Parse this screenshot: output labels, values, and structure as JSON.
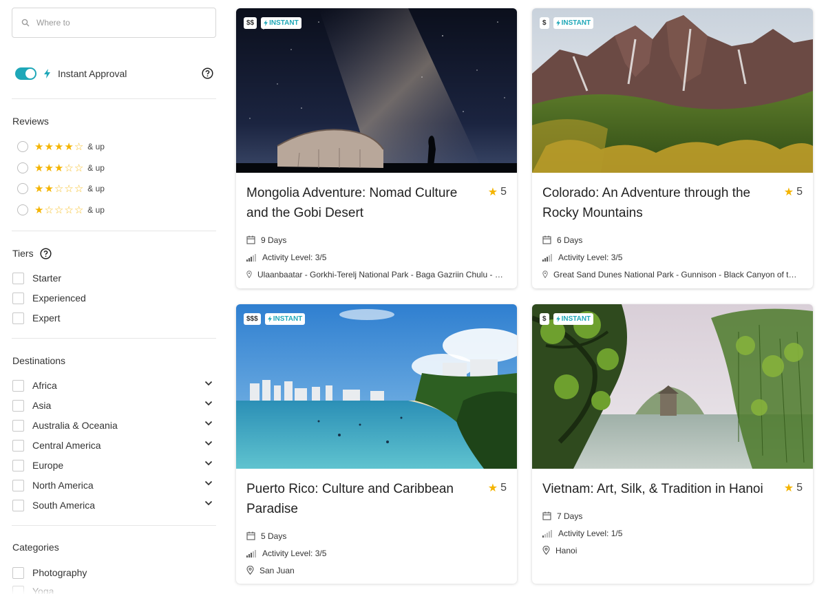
{
  "search": {
    "placeholder": "Where to"
  },
  "instant_approval": {
    "label": "Instant Approval",
    "enabled": true
  },
  "reviews": {
    "title": "Reviews",
    "options": [
      {
        "stars": 4,
        "suffix": "& up"
      },
      {
        "stars": 3,
        "suffix": "& up"
      },
      {
        "stars": 2,
        "suffix": "& up"
      },
      {
        "stars": 1,
        "suffix": "& up"
      }
    ]
  },
  "tiers": {
    "title": "Tiers",
    "options": [
      "Starter",
      "Experienced",
      "Expert"
    ]
  },
  "destinations": {
    "title": "Destinations",
    "options": [
      "Africa",
      "Asia",
      "Australia & Oceania",
      "Central America",
      "Europe",
      "North America",
      "South America"
    ]
  },
  "categories": {
    "title": "Categories",
    "options": [
      "Photography",
      "Yoga"
    ]
  },
  "colors": {
    "accent": "#1ea7b8",
    "star": "#f4b400"
  },
  "trips": [
    {
      "price": "$$",
      "instant": "INSTANT",
      "title": "Mongolia Adventure: Nomad Culture and the Gobi Desert",
      "rating": "5",
      "duration": "9 Days",
      "activity": "Activity Level: 3/5",
      "location": "Ulaanbaatar - Gorkhi-Terelj National Park - Baga Gazriin Chulu - Gobi Desert"
    },
    {
      "price": "$",
      "instant": "INSTANT",
      "title": "Colorado: An Adventure through the Rocky Mountains",
      "rating": "5",
      "duration": "6 Days",
      "activity": "Activity Level: 3/5",
      "location": "Great Sand Dunes National Park - Gunnison - Black Canyon of the Gunnison"
    },
    {
      "price": "$$$",
      "instant": "INSTANT",
      "title": "Puerto Rico: Culture and Caribbean Paradise",
      "rating": "5",
      "duration": "5 Days",
      "activity": "Activity Level: 3/5",
      "location": "San Juan"
    },
    {
      "price": "$",
      "instant": "INSTANT",
      "title": "Vietnam: Art, Silk, & Tradition in Hanoi",
      "rating": "5",
      "duration": "7 Days",
      "activity": "Activity Level: 1/5",
      "location": "Hanoi"
    }
  ]
}
